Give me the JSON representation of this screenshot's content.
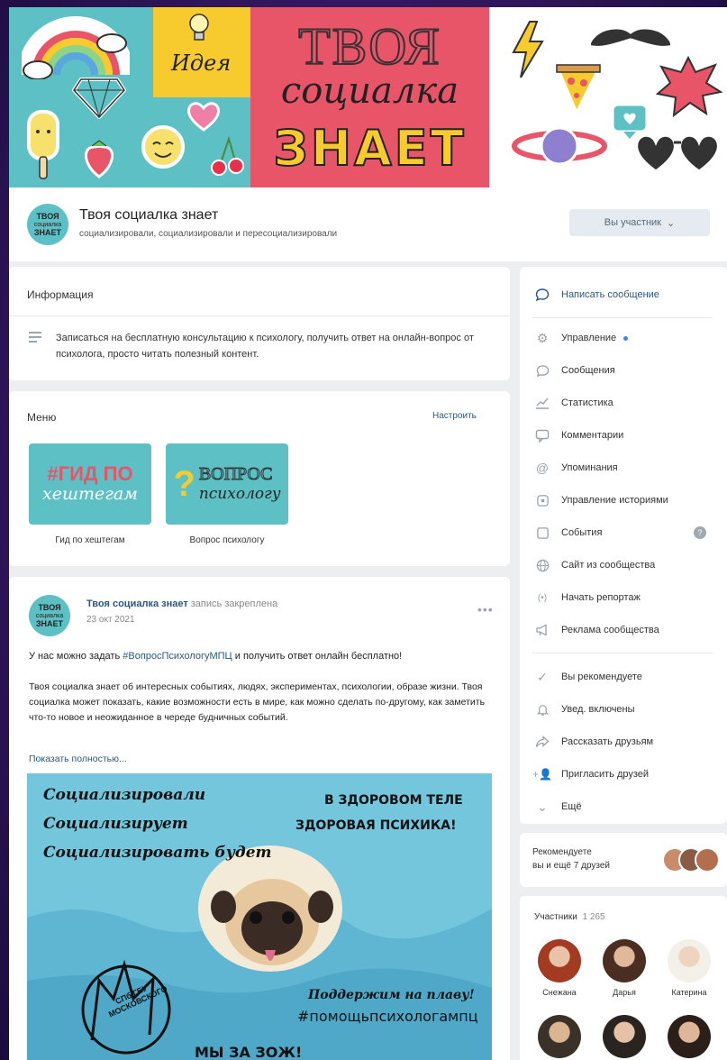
{
  "cover": {
    "word_idea": "Идея",
    "title_line1": "ТВОЯ",
    "title_line2": "социалка",
    "title_line3": "ЗНАЕТ",
    "colors": {
      "teal": "#5cc0c5",
      "yellow": "#f7cb2d",
      "red": "#e85468"
    }
  },
  "header": {
    "avatar_text": [
      "ТВОЯ",
      "социалка",
      "ЗНАЕТ"
    ],
    "group_name": "Твоя социалка знает",
    "status": "социализировали, социализировали и пересоциализировали",
    "member_button": "Вы участник",
    "member_button_icon": "chevron-down-icon"
  },
  "info": {
    "title": "Информация",
    "description": "Записаться на бесплатную консультацию к психологу, получить ответ на онлайн-вопрос от психолога, просто читать полезный контент."
  },
  "menu": {
    "title": "Меню",
    "configure": "Настроить",
    "tiles": [
      {
        "image_text": [
          "#ГИД ПО",
          "хештегам"
        ],
        "label": "Гид по хештегам"
      },
      {
        "image_text": [
          "ВОПРОС",
          "психологу"
        ],
        "label": "Вопрос психологу"
      }
    ]
  },
  "side_menu": {
    "items": [
      {
        "label": "Написать сообщение",
        "icon": "message-icon"
      },
      {
        "label": "Управление",
        "icon": "gear-icon"
      },
      {
        "label": "Сообщения",
        "icon": "chat-icon"
      },
      {
        "label": "Статистика",
        "icon": "stats-icon"
      },
      {
        "label": "Комментарии",
        "icon": "comment-icon"
      },
      {
        "label": "Упоминания",
        "icon": "at-icon"
      },
      {
        "label": "Управление историями",
        "icon": "stories-icon"
      },
      {
        "label": "События",
        "icon": "events-icon"
      },
      {
        "label": "Сайт из сообщества",
        "icon": "globe-icon"
      },
      {
        "label": "Начать репортаж",
        "icon": "broadcast-icon"
      },
      {
        "label": "Реклама сообщества",
        "icon": "megaphone-icon"
      },
      {
        "label": "Вы рекомендуете",
        "icon": "check-icon"
      },
      {
        "label": "Увед. включены",
        "icon": "bell-icon"
      },
      {
        "label": "Рассказать друзьям",
        "icon": "share-icon"
      },
      {
        "label": "Пригласить друзей",
        "icon": "add-user-icon"
      },
      {
        "label": "Ещё",
        "icon": "chevron-down-icon"
      }
    ],
    "question_badge": "?"
  },
  "recommend": {
    "line1": "Рекомендуете",
    "line2": "вы и ещё 7 друзей"
  },
  "members": {
    "title": "Участники",
    "count": "1 265",
    "people": [
      {
        "name": "Снежана"
      },
      {
        "name": "Дарья"
      },
      {
        "name": "Катерина"
      }
    ]
  },
  "post": {
    "avatar_text": [
      "ТВОЯ",
      "социалка",
      "ЗНАЕТ"
    ],
    "author": "Твоя социалка знает",
    "pinned": "запись закреплена",
    "date": "23 окт 2021",
    "more": "•••",
    "line1_before": "У нас можно задать ",
    "hashtag": "#ВопросПсихологуМПЦ",
    "line1_after": " и получить ответ онлайн бесплатно!",
    "body": "Твоя социалка знает об интересных событиях, людях, экспериментах, психологии, образе жизни. Твоя социалка может показать, какие возможности есть в мире, как можно сделать по-другому, как заметить что-то новое и неожиданное в череде будничных событий.",
    "show_more": "Показать полностью...",
    "image": {
      "left_lines": [
        "Социализировали",
        "Социализирует",
        "Социализировать будет"
      ],
      "right_top": [
        "В ЗДОРОВОМ ТЕЛЕ",
        "ЗДОРОВАЯ ПСИХИКА!"
      ],
      "right_bottom": [
        "Поддержим на плаву!",
        "#помощьпсихологампц"
      ],
      "bottom": "МЫ ЗА ЗОЖ!",
      "stamp": "СПб ГБУ МОСКОВСКОГО"
    }
  }
}
